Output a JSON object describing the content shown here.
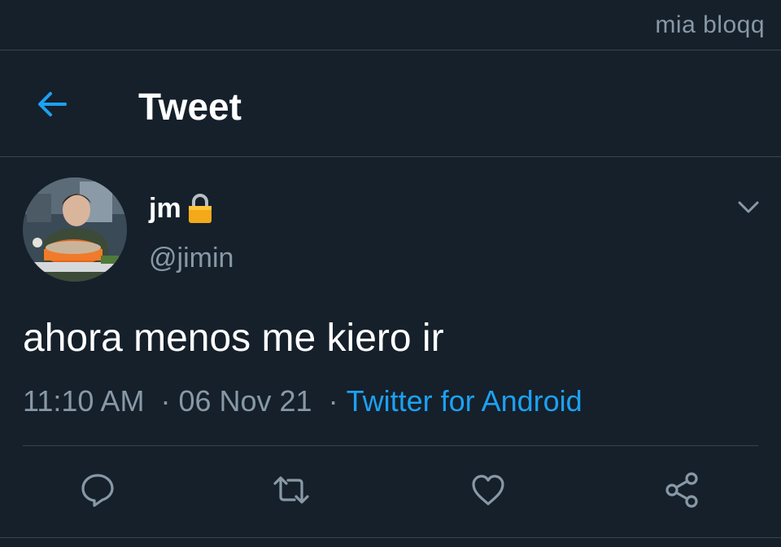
{
  "watermark": "mia bloqq",
  "header": {
    "back_icon": "back-arrow-icon",
    "title": "Tweet"
  },
  "tweet": {
    "display_name": "jm",
    "lock_icon": "lock-icon",
    "handle": "@jimin",
    "text": "ahora menos me kiero ir",
    "time": "11:10 AM",
    "separator": "·",
    "date": "06 Nov 21",
    "source": "Twitter for Android"
  },
  "actions": [
    {
      "icon": "reply-icon"
    },
    {
      "icon": "retweet-icon"
    },
    {
      "icon": "like-icon"
    },
    {
      "icon": "share-icon"
    }
  ],
  "colors": {
    "background": "#15202b",
    "accent": "#1da1f2",
    "secondary_text": "#8899a6",
    "divider": "#38444d"
  }
}
